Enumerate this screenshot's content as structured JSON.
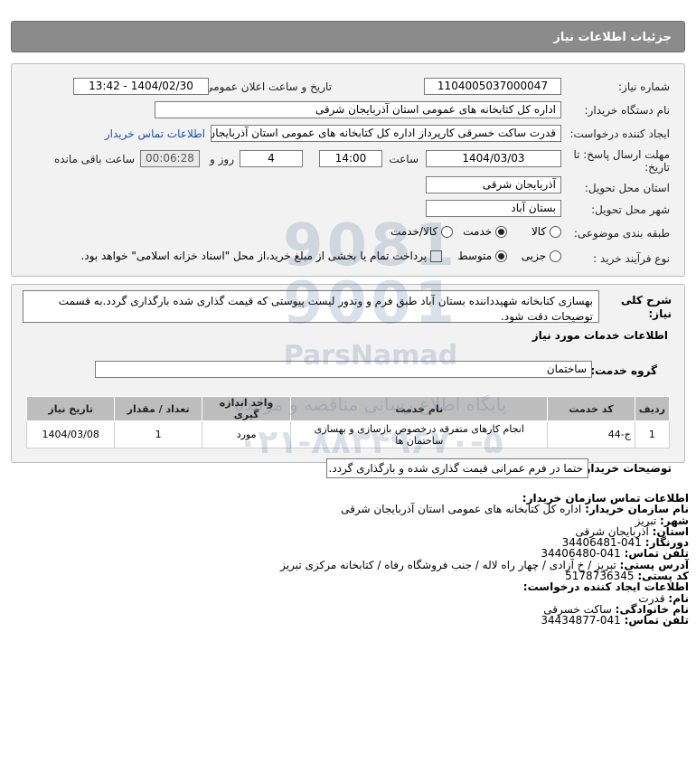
{
  "header": {
    "title": "جزئیات اطلاعات نیاز"
  },
  "form": {
    "need_number_label": "شماره نیاز:",
    "need_number": "1104005037000047",
    "announce_label": "تاریخ و ساعت اعلان عمومی:",
    "announce_value": "1404/02/30 - 13:42",
    "buyer_org_label": "نام دستگاه خریدار:",
    "buyer_org": "اداره کل کتابخانه های عمومی استان آذربایجان شرقی",
    "creator_label": "ایجاد کننده درخواست:",
    "creator": "قدرت ساکت خسرقی کارپرداز اداره کل کتابخانه های عمومی استان آذربایجان ش",
    "contact_link": "اطلاعات تماس خریدار",
    "deadline_label_1": "مهلت ارسال پاسخ: تا",
    "deadline_label_2": "تاریخ:",
    "deadline_date": "1404/03/03",
    "time_label": "ساعت",
    "deadline_time": "14:00",
    "days_value": "4",
    "days_label": "روز و",
    "remaining_time": "00:06:28",
    "remaining_label": "ساعت باقی مانده",
    "province_label": "استان محل تحویل:",
    "province": "آذربایجان شرقی",
    "city_label": "شهر محل تحویل:",
    "city": "بستان آباد",
    "category_label": "طبقه بندی موضوعی:",
    "category_options": [
      "کالا",
      "خدمت",
      "کالا/خدمت"
    ],
    "category_selected": "خدمت",
    "process_label": "نوع فرآیند خرید :",
    "process_options": [
      "جزیی",
      "متوسط"
    ],
    "process_selected": "متوسط",
    "payment_note": "پرداخت تمام یا بخشی از مبلغ خرید،از محل \"اسناد خزانه اسلامی\" خواهد بود."
  },
  "details": {
    "summary_label": "شرح کلی نیاز:",
    "summary": "بهسازی کتابخانه شهیدداننده بستان آباد طبق فرم و وندور لیست پیوستی که قیمت گذاری شده بارگذاری گردد.به قسمت توضیحات دقت شود.",
    "services_heading": "اطلاعات خدمات مورد نیاز",
    "service_group_label": "گروه خدمت:",
    "service_group": "ساختمان",
    "table_headers": [
      "ردیف",
      "کد خدمت",
      "نام خدمت",
      "واحد اندازه گیری",
      "تعداد / مقدار",
      "تاریخ نیاز"
    ],
    "table_rows": [
      [
        "1",
        "ج-44",
        "انجام کارهای متفرقه درخصوص بازسازی و بهسازی ساختمان ها",
        "مورد",
        "1",
        "1404/03/08"
      ]
    ],
    "buyer_notes_label": "توضیحات خریدار:",
    "buyer_notes": "حتما در فرم عمرانی قیمت گذاری شده و بارگذاری گردد."
  },
  "contact": {
    "org_heading": "اطلاعات تماس سازمان خریدار:",
    "org_name_label": "نام سازمان خریدار:",
    "org_name": "اداره کل کتابخانه های عمومی استان آذربایجان شرقی",
    "city_label": "شهر:",
    "city": "تبریز",
    "province_label": "استان:",
    "province": "آذربایجان شرقی",
    "fax_label": "دورنگار:",
    "fax": "041-34406481",
    "phone_label": "تلفن تماس:",
    "phone": "041-34406480",
    "address_label": "آدرس پستی:",
    "address": "تبریز / خ آزادی / چهار راه لاله / جنب فروشگاه رفاه / کتابخانه مرکزی تبریز",
    "postal_label": "کد پستی:",
    "postal": "5178736345",
    "creator_heading": "اطلاعات ایجاد کننده درخواست:",
    "first_name_label": "نام:",
    "first_name": "قدرت",
    "last_name_label": "نام خانوادگی:",
    "last_name": "ساکت خسرقی",
    "creator_phone_label": "تلفن تماس:",
    "creator_phone": "041-34434877"
  },
  "watermark": {
    "brand": "ParsNamad",
    "line1": "پایگاه اطلاع رسانی مناقصه و مزایده",
    "phone": "۰۲۱-۸۸۳۴۹۶۷۰-۵"
  }
}
